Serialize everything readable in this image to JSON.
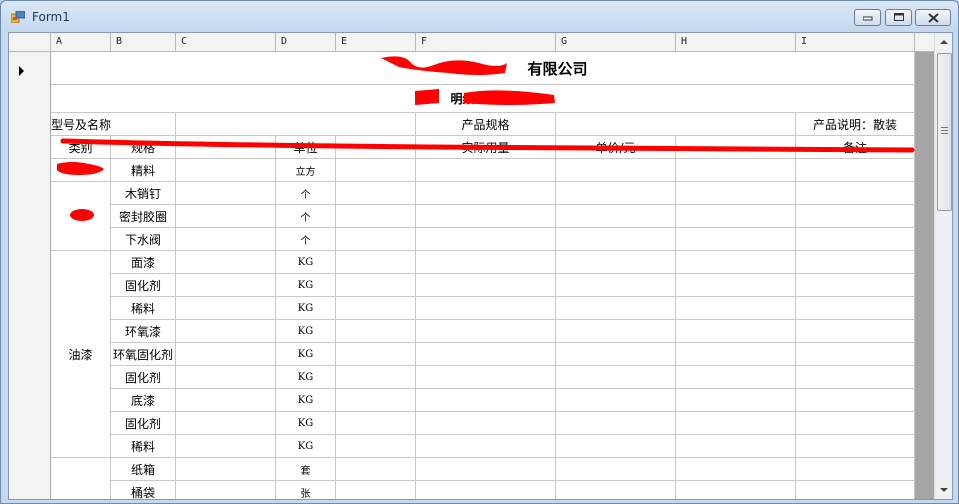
{
  "window": {
    "title": "Form1"
  },
  "columns": [
    "A",
    "B",
    "C",
    "D",
    "E",
    "F",
    "G",
    "H",
    "I"
  ],
  "sheet": {
    "company_title": "有限公司",
    "subtitle": "明细",
    "row3": {
      "label": "型号及名称",
      "spec": "产品规格",
      "note": "产品说明：散装"
    },
    "header": [
      "类别",
      "规格",
      "",
      "单位",
      "",
      "实际用量",
      "单价/元",
      "",
      "备注"
    ],
    "rows": [
      {
        "b": "精料",
        "d": "立方"
      },
      {
        "b": "木销钉",
        "d": "个"
      },
      {
        "b": "密封胶圈",
        "d": "个"
      },
      {
        "b": "下水阀",
        "d": "个"
      },
      {
        "b": "面漆",
        "d": "KG"
      },
      {
        "b": "固化剂",
        "d": "KG"
      },
      {
        "b": "稀料",
        "d": "KG"
      },
      {
        "b": "环氧漆",
        "d": "KG"
      },
      {
        "b": "环氧固化剂",
        "d": "KG"
      },
      {
        "b": "固化剂",
        "d": "KG"
      },
      {
        "b": "底漆",
        "d": "KG"
      },
      {
        "b": "固化剂",
        "d": "KG"
      },
      {
        "b": "稀料",
        "d": "KG"
      },
      {
        "b": "纸箱",
        "d": "套"
      },
      {
        "b": "桶袋",
        "d": "张"
      }
    ],
    "group_label": "油漆"
  },
  "colors": {
    "redaction": "#ff0000",
    "frame": "#c4d8ee"
  },
  "icons": {
    "app": "app-icon",
    "min": "minimize-icon",
    "max": "maximize-icon",
    "close": "close-icon",
    "row_pointer": "row-pointer-icon"
  }
}
